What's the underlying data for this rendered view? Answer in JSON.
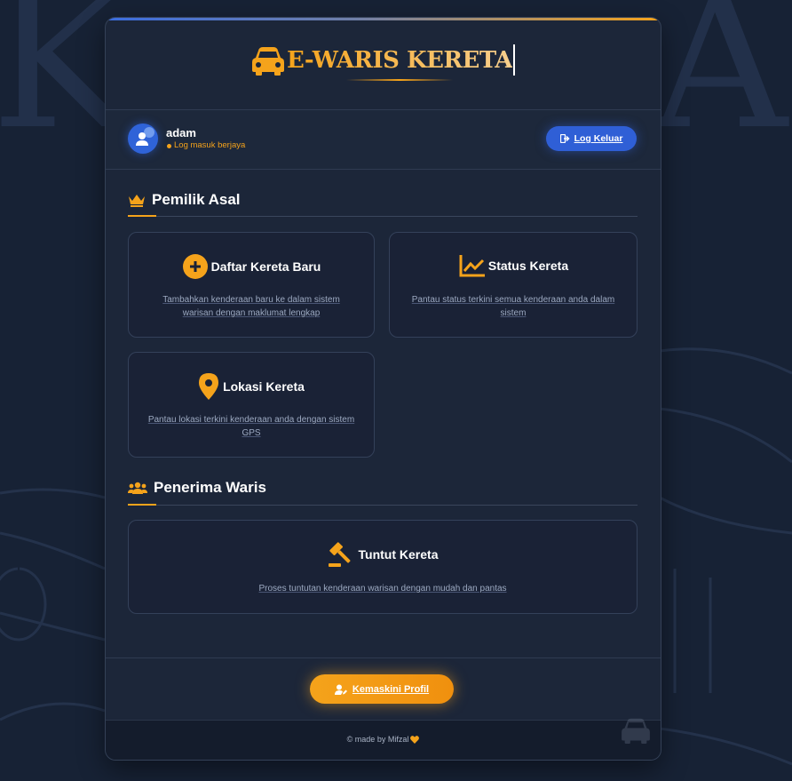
{
  "app": {
    "title": "E-WARIS KERETA",
    "accent_color": "#f5a31b",
    "primary_color": "#2f5fd6",
    "brand_icon": "car-icon",
    "background_letters": [
      "K",
      "A"
    ]
  },
  "user": {
    "name": "adam",
    "status": "Log masuk berjaya",
    "avatar_icon": "user-icon"
  },
  "logout": {
    "label": "Log Keluar",
    "icon": "sign-out-icon"
  },
  "sections": [
    {
      "title": "Pemilik Asal",
      "icon": "crown-icon",
      "tiles": [
        {
          "title": "Daftar Kereta Baru",
          "icon": "plus-circle-icon",
          "description": "Tambahkan kenderaan baru ke dalam sistem warisan dengan maklumat lengkap"
        },
        {
          "title": "Status Kereta",
          "icon": "line-chart-icon",
          "description": "Pantau status terkini semua kenderaan anda dalam sistem"
        },
        {
          "title": "Lokasi Kereta",
          "icon": "map-marker-icon",
          "description": "Pantau lokasi terkini kenderaan anda dengan sistem GPS"
        }
      ]
    },
    {
      "title": "Penerima Waris",
      "icon": "users-icon",
      "tiles": [
        {
          "title": "Tuntut Kereta",
          "icon": "gavel-icon",
          "description": "Proses tuntutan kenderaan warisan dengan mudah dan pantas"
        }
      ]
    }
  ],
  "profile_button": {
    "label": "Kemaskini Profil",
    "icon": "user-edit-icon"
  },
  "footer": {
    "credit": "© made by Mifzal",
    "icon": "heart-icon"
  }
}
